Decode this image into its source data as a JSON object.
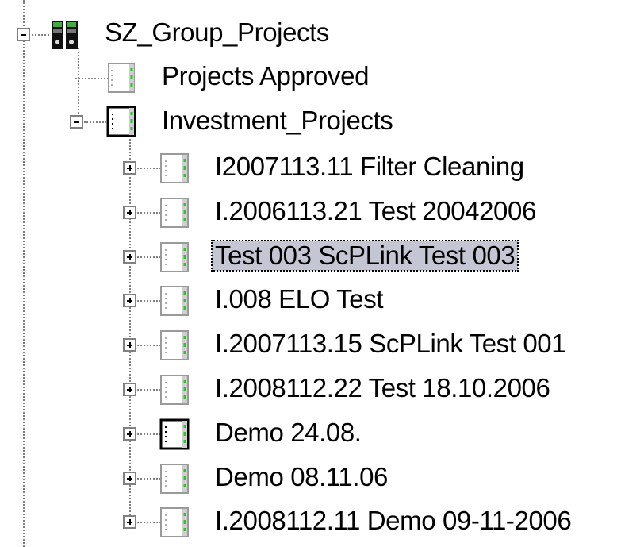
{
  "tree": {
    "root": {
      "label": "SZ_Group_Projects",
      "icon": "server-rack-icon",
      "expanded": true
    },
    "approved": {
      "label": "Projects Approved",
      "icon": "binder-icon"
    },
    "investment": {
      "label": "Investment_Projects",
      "icon": "binder-icon",
      "expanded": true
    },
    "projects": [
      {
        "label": "I2007113.11 Filter Cleaning",
        "selected": false,
        "bold_icon": false
      },
      {
        "label": "I.2006113.21 Test 20042006",
        "selected": false,
        "bold_icon": false
      },
      {
        "label": "Test 003 ScPLink Test 003",
        "selected": true,
        "bold_icon": false
      },
      {
        "label": "I.008 ELO Test",
        "selected": false,
        "bold_icon": false
      },
      {
        "label": "I.2007113.15 ScPLink Test 001",
        "selected": false,
        "bold_icon": false
      },
      {
        "label": "I.2008112.22 Test 18.10.2006",
        "selected": false,
        "bold_icon": false
      },
      {
        "label": "Demo 24.08.",
        "selected": false,
        "bold_icon": true
      },
      {
        "label": "Demo 08.11.06",
        "selected": false,
        "bold_icon": false
      },
      {
        "label": "I.2008112.11 Demo 09-11-2006",
        "selected": false,
        "bold_icon": false
      }
    ],
    "colors": {
      "selection": "#c4c7d3",
      "connector": "#808080",
      "binder_accent": "#22cc22"
    }
  }
}
